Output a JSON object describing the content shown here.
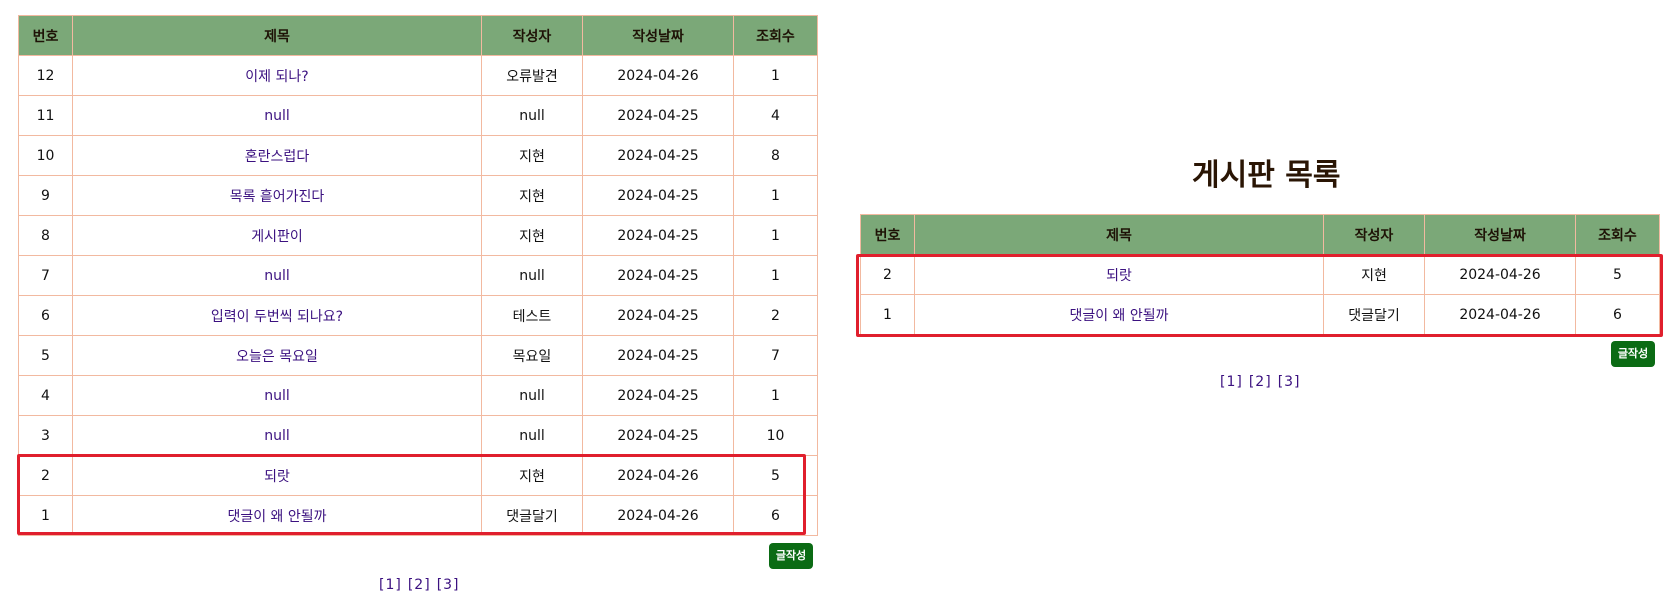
{
  "columns": [
    "번호",
    "제목",
    "작성자",
    "작성날짜",
    "조회수"
  ],
  "left_board": {
    "rows": [
      {
        "no": "12",
        "title": "이제 되나?",
        "author": "오류발견",
        "date": "2024-04-26",
        "views": "1"
      },
      {
        "no": "11",
        "title": "null",
        "author": "null",
        "date": "2024-04-25",
        "views": "4"
      },
      {
        "no": "10",
        "title": "혼란스럽다",
        "author": "지현",
        "date": "2024-04-25",
        "views": "8"
      },
      {
        "no": "9",
        "title": "목록 흩어가진다",
        "author": "지현",
        "date": "2024-04-25",
        "views": "1"
      },
      {
        "no": "8",
        "title": "게시판이",
        "author": "지현",
        "date": "2024-04-25",
        "views": "1"
      },
      {
        "no": "7",
        "title": "null",
        "author": "null",
        "date": "2024-04-25",
        "views": "1"
      },
      {
        "no": "6",
        "title": "입력이 두번씩 되나요?",
        "author": "테스트",
        "date": "2024-04-25",
        "views": "2"
      },
      {
        "no": "5",
        "title": "오늘은 목요일",
        "author": "목요일",
        "date": "2024-04-25",
        "views": "7"
      },
      {
        "no": "4",
        "title": "null",
        "author": "null",
        "date": "2024-04-25",
        "views": "1"
      },
      {
        "no": "3",
        "title": "null",
        "author": "null",
        "date": "2024-04-25",
        "views": "10"
      },
      {
        "no": "2",
        "title": "되랏",
        "author": "지현",
        "date": "2024-04-26",
        "views": "5"
      },
      {
        "no": "1",
        "title": "댓글이 왜 안될까",
        "author": "댓글달기",
        "date": "2024-04-26",
        "views": "6"
      }
    ],
    "write_label": "글작성",
    "pages": [
      "[1]",
      "[2]",
      "[3]"
    ]
  },
  "right_board": {
    "heading": "게시판 목록",
    "rows": [
      {
        "no": "2",
        "title": "되랏",
        "author": "지현",
        "date": "2024-04-26",
        "views": "5"
      },
      {
        "no": "1",
        "title": "댓글이 왜 안될까",
        "author": "댓글달기",
        "date": "2024-04-26",
        "views": "6"
      }
    ],
    "write_label": "글작성",
    "pages": [
      "[1]",
      "[2]",
      "[3]"
    ]
  },
  "colors": {
    "header_bg": "#7ba878",
    "cell_border": "#f2b9a0",
    "link": "#3b1180",
    "button_bg": "#0b6b14",
    "highlight": "#e01f2d"
  }
}
